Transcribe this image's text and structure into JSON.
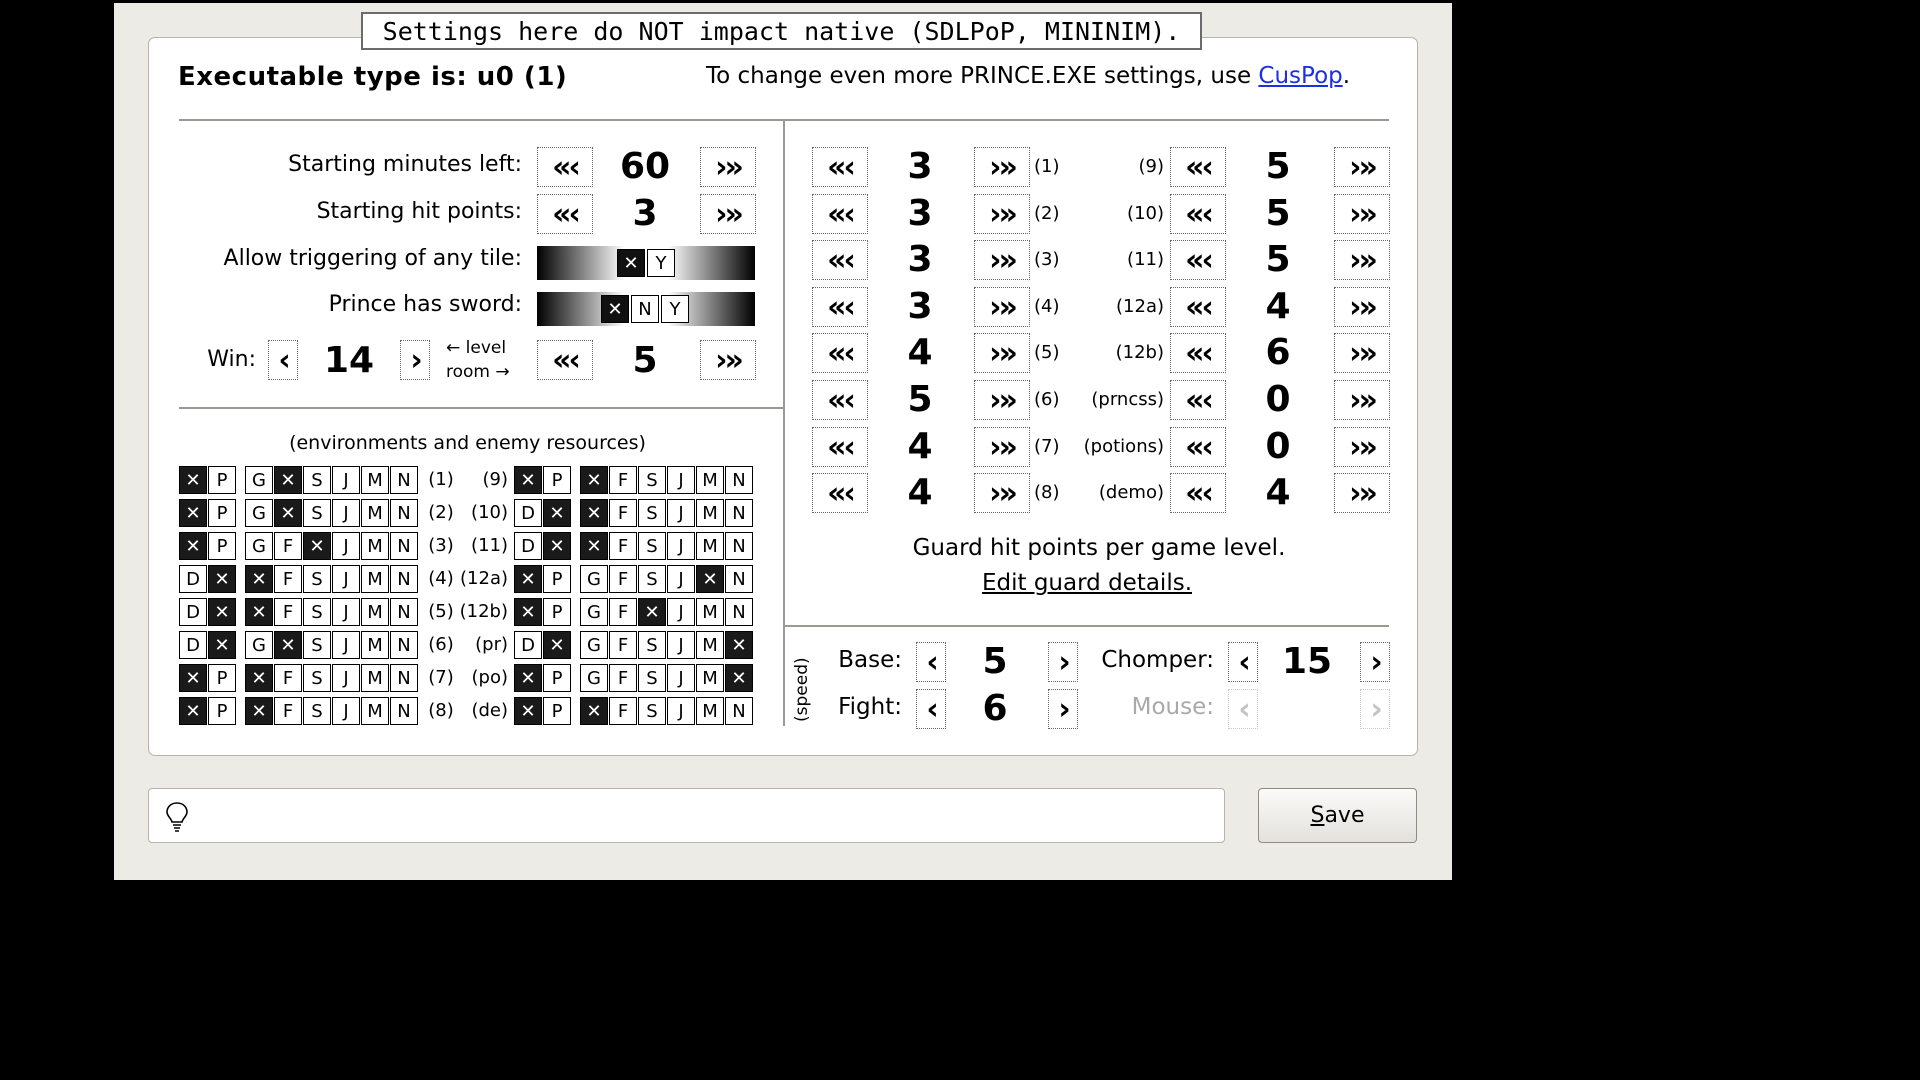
{
  "banner": "Settings here do NOT impact native (SDLPoP, MININIM).",
  "header": {
    "exe_type": "Executable type is: u0 (1)",
    "more_text": "To change even more PRINCE.EXE settings, use ",
    "more_link": "CusPop",
    "more_end": "."
  },
  "left": {
    "minutes_label": "Starting minutes left:",
    "minutes_value": "60",
    "hp_label": "Starting hit points:",
    "hp_value": "3",
    "trigger_label": "Allow triggering of any tile:",
    "trigger_y": "Y",
    "sword_label": "Prince has sword:",
    "sword_n": "N",
    "sword_y": "Y",
    "win_label": "Win:",
    "win_level": "14",
    "level_text": "← level",
    "room_text": "room →",
    "win_room": "5"
  },
  "arrows": {
    "dbl_left": "«‹",
    "dbl_right": "›»",
    "left": "‹",
    "right": "›"
  },
  "env": {
    "title": "(environments and enemy resources)",
    "letters": [
      "D",
      "P",
      "G",
      "F",
      "S",
      "J",
      "M",
      "N"
    ],
    "left_labels": [
      "(1)",
      "(2)",
      "(3)",
      "(4)",
      "(5)",
      "(6)",
      "(7)",
      "(8)"
    ],
    "right_labels": [
      "(9)",
      "(10)",
      "(11)",
      "(12a)",
      "(12b)",
      "(pr)",
      "(po)",
      "(de)"
    ]
  },
  "guards": {
    "left": [
      {
        "value": "3",
        "label": "(1)"
      },
      {
        "value": "3",
        "label": "(2)"
      },
      {
        "value": "3",
        "label": "(3)"
      },
      {
        "value": "3",
        "label": "(4)"
      },
      {
        "value": "4",
        "label": "(5)"
      },
      {
        "value": "5",
        "label": "(6)"
      },
      {
        "value": "4",
        "label": "(7)"
      },
      {
        "value": "4",
        "label": "(8)"
      }
    ],
    "right": [
      {
        "value": "5",
        "label": "(9)"
      },
      {
        "value": "5",
        "label": "(10)"
      },
      {
        "value": "5",
        "label": "(11)"
      },
      {
        "value": "4",
        "label": "(12a)"
      },
      {
        "value": "6",
        "label": "(12b)"
      },
      {
        "value": "0",
        "label": "(prncss)"
      },
      {
        "value": "0",
        "label": "(potions)"
      },
      {
        "value": "4",
        "label": "(demo)"
      }
    ],
    "caption": "Guard hit points per game level.",
    "edit_link": "Edit guard details."
  },
  "speed": {
    "side": "(speed)",
    "base_label": "Base:",
    "base_value": "5",
    "fight_label": "Fight:",
    "fight_value": "6",
    "chomper_label": "Chomper:",
    "chomper_value": "15",
    "mouse_label": "Mouse:"
  },
  "footer": {
    "save_pre": "",
    "save_u": "S",
    "save_rest": "ave",
    "tip_icon": "lightbulb-icon"
  }
}
